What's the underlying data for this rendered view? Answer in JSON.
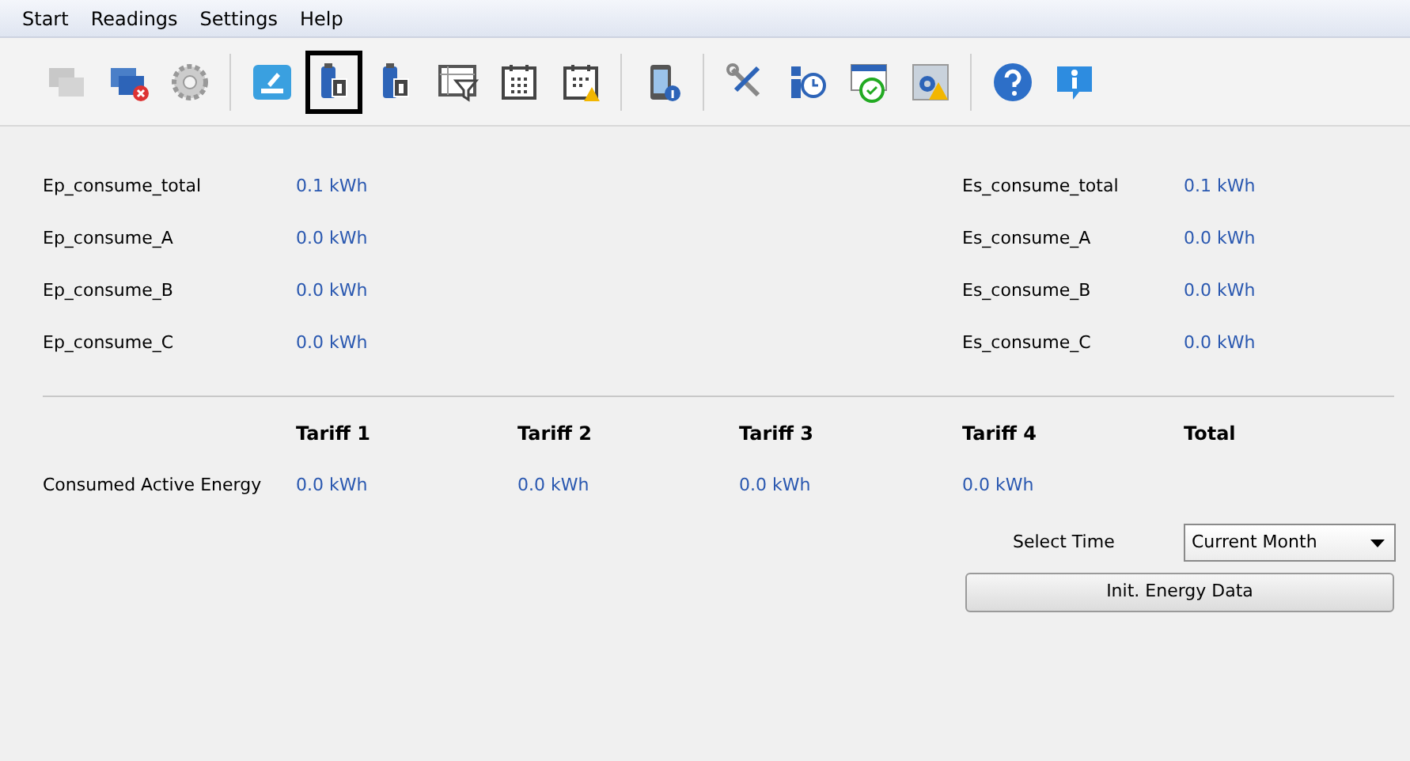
{
  "menu": [
    "Start",
    "Readings",
    "Settings",
    "Help"
  ],
  "toolbar": [
    [
      {
        "kind": "windows",
        "selected": false,
        "disabled": true
      },
      {
        "kind": "disconnect",
        "selected": false,
        "disabled": false
      },
      {
        "kind": "gear",
        "selected": false,
        "disabled": false
      }
    ],
    [
      {
        "kind": "edit",
        "selected": false,
        "disabled": false
      },
      {
        "kind": "battery1",
        "selected": true,
        "disabled": false
      },
      {
        "kind": "battery2",
        "selected": false,
        "disabled": false
      },
      {
        "kind": "filter",
        "selected": false,
        "disabled": false
      },
      {
        "kind": "calendar",
        "selected": false,
        "disabled": false
      },
      {
        "kind": "calendarwarn",
        "selected": false,
        "disabled": false
      }
    ],
    [
      {
        "kind": "phoneinfo",
        "selected": false,
        "disabled": false
      }
    ],
    [
      {
        "kind": "tools",
        "selected": false,
        "disabled": false
      },
      {
        "kind": "clockbars",
        "selected": false,
        "disabled": false
      },
      {
        "kind": "calendarclock",
        "selected": false,
        "disabled": false
      },
      {
        "kind": "gearwarn",
        "selected": false,
        "disabled": false
      }
    ],
    [
      {
        "kind": "help",
        "selected": false,
        "disabled": false
      },
      {
        "kind": "info",
        "selected": false,
        "disabled": false
      }
    ]
  ],
  "consumption": {
    "left": [
      {
        "label": "Ep_consume_total",
        "value": "0.1 kWh"
      },
      {
        "label": "Ep_consume_A",
        "value": "0.0 kWh"
      },
      {
        "label": "Ep_consume_B",
        "value": "0.0 kWh"
      },
      {
        "label": "Ep_consume_C",
        "value": "0.0 kWh"
      }
    ],
    "right": [
      {
        "label": "Es_consume_total",
        "value": "0.1 kWh"
      },
      {
        "label": "Es_consume_A",
        "value": "0.0 kWh"
      },
      {
        "label": "Es_consume_B",
        "value": "0.0 kWh"
      },
      {
        "label": "Es_consume_C",
        "value": "0.0 kWh"
      }
    ]
  },
  "tariffs": {
    "columns": [
      "Tariff 1",
      "Tariff 2",
      "Tariff 3",
      "Tariff 4",
      "Total"
    ],
    "rows": [
      {
        "label": "Consumed Active Energy",
        "values": [
          "0.0 kWh",
          "0.0 kWh",
          "0.0 kWh",
          "0.0 kWh"
        ]
      }
    ]
  },
  "select_time": {
    "label": "Select Time",
    "value": "Current Month"
  },
  "buttons": [
    "Init. Energy Data"
  ]
}
